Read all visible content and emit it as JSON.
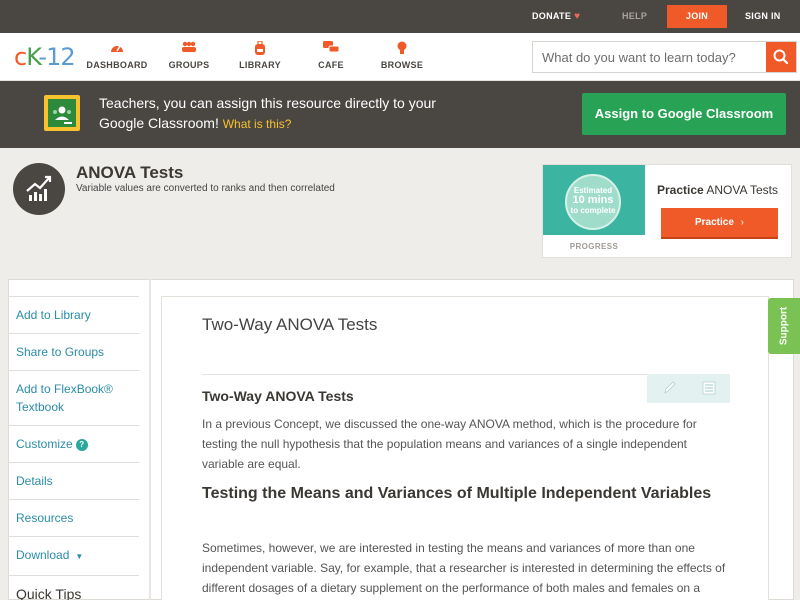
{
  "topbar": {
    "donate": "DONATE",
    "help": "HELP",
    "join": "JOIN",
    "signin": "SIGN IN"
  },
  "nav": {
    "logo": {
      "part1": "c",
      "part2": "K",
      "part3": "-12"
    },
    "items": [
      {
        "label": "DASHBOARD",
        "icon": "gauge-icon"
      },
      {
        "label": "GROUPS",
        "icon": "groups-icon"
      },
      {
        "label": "LIBRARY",
        "icon": "backpack-icon"
      },
      {
        "label": "CAFE",
        "icon": "chat-bubbles-icon"
      },
      {
        "label": "BROWSE",
        "icon": "lightbulb-icon"
      }
    ],
    "search_placeholder": "What do you want to learn today?"
  },
  "classroom_banner": {
    "text": "Teachers, you can assign this resource directly to your Google Classroom!",
    "what_link": "What is this?",
    "button": "Assign to Google Classroom"
  },
  "concept": {
    "title": "ANOVA Tests",
    "subtitle": "Variable values are converted to ranks and then correlated"
  },
  "practice": {
    "estimate_line1": "Estimated",
    "estimate_line2": "10 mins",
    "estimate_line3": "to complete",
    "progress_label": "PROGRESS",
    "title_bold": "Practice",
    "title_rest": " ANOVA Tests",
    "button": "Practice"
  },
  "sidebar": {
    "items": [
      "Add to Library",
      "Share to Groups",
      "Add to FlexBook® Textbook",
      "Customize",
      "Details",
      "Resources",
      "Download"
    ],
    "quick_tips": "Quick Tips"
  },
  "article": {
    "title": "Two-Way ANOVA Tests",
    "heading": "Two-Way ANOVA Tests",
    "para1": "In a previous Concept, we discussed the one-way ANOVA method, which is the procedure for testing the null hypothesis that the population means and variances of a single independent variable are equal.",
    "subheading": "Testing the Means and Variances of Multiple Independent Variables",
    "para2": "Sometimes, however, we are interested in testing the means and variances of more than one independent variable. Say, for example, that a researcher is interested in determining the effects of different dosages of a dietary supplement on the performance of both males and females on a"
  },
  "support": "Support",
  "colors": {
    "accent": "#f05a28",
    "dark": "#4a4642",
    "green": "#28a356",
    "link": "#2a8ca8"
  }
}
